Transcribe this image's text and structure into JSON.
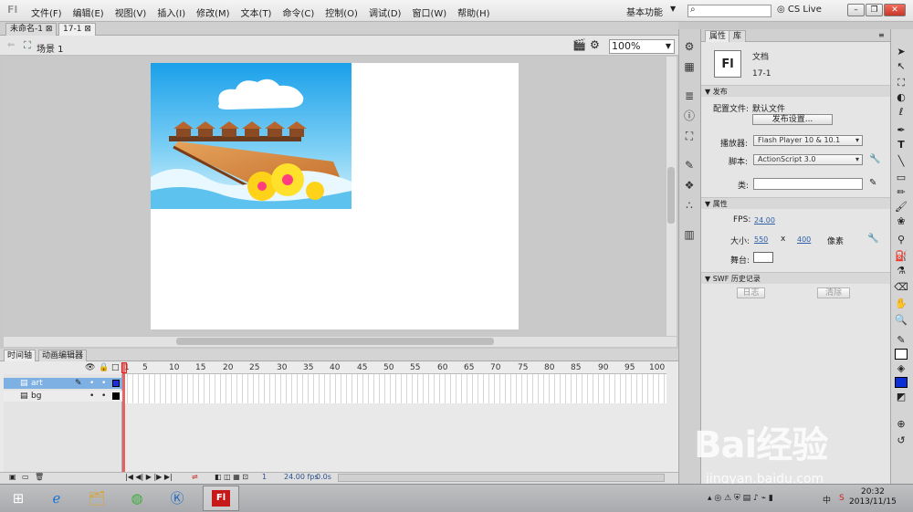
{
  "app": {
    "logo": "Fl"
  },
  "menu": [
    "文件(F)",
    "编辑(E)",
    "视图(V)",
    "插入(I)",
    "修改(M)",
    "文本(T)",
    "命令(C)",
    "控制(O)",
    "调试(D)",
    "窗口(W)",
    "帮助(H)"
  ],
  "topbar": {
    "workspace": "基本功能",
    "search_placeholder": "",
    "cs_live": "CS Live"
  },
  "tabs": [
    "未命名-1",
    "17-1"
  ],
  "editbar": {
    "scene": "场景 1",
    "zoom": "100%"
  },
  "timeline": {
    "tabs": [
      "时间轴",
      "动画编辑器"
    ],
    "frame_numbers": [
      "1",
      "5",
      "10",
      "15",
      "20",
      "25",
      "30",
      "35",
      "40",
      "45",
      "50",
      "55",
      "60",
      "65",
      "70",
      "75",
      "80",
      "85",
      "90",
      "95",
      "100"
    ],
    "layers": [
      "art",
      "bg"
    ],
    "footer": {
      "frame": "1",
      "fps": "24.00",
      "fps_unit": "fps",
      "time": "0.0s"
    }
  },
  "properties": {
    "tabs": [
      "属性",
      "库"
    ],
    "doc_label": "文档",
    "doc_name": "17-1",
    "publish": {
      "header": "发布",
      "profile_label": "配置文件:",
      "profile_value": "默认文件",
      "settings_button": "发布设置...",
      "player_label": "播放器:",
      "player_value": "Flash Player 10 & 10.1",
      "script_label": "脚本:",
      "script_value": "ActionScript 3.0",
      "class_label": "类:"
    },
    "props": {
      "header": "属性",
      "fps_label": "FPS:",
      "fps_value": "24.00",
      "size_label": "大小:",
      "width": "550",
      "x": "x",
      "height": "400",
      "unit": "像素",
      "stage_label": "舞台:"
    },
    "swf": {
      "header": "SWF 历史记录",
      "log_button": "日志",
      "clear_button": "清除"
    }
  },
  "taskbar": {
    "time": "20:32",
    "date": "2013/11/15",
    "ime": "中"
  },
  "watermark": {
    "text": "Bai经验",
    "url": "jingyan.baidu.com"
  }
}
